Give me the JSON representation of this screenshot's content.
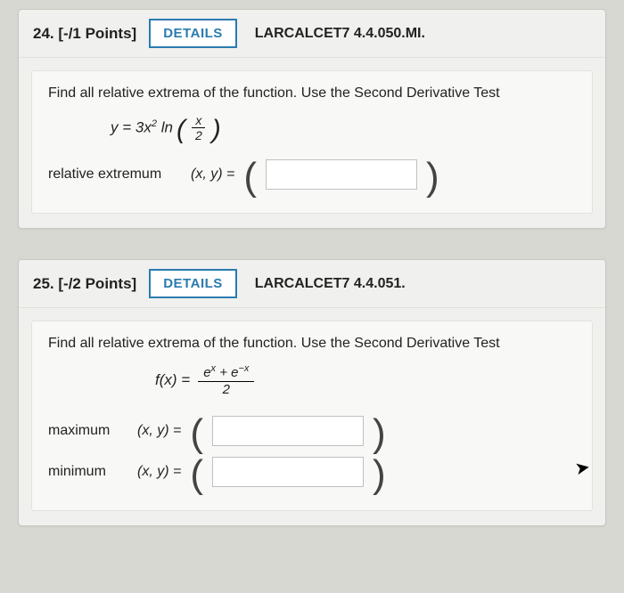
{
  "q24": {
    "number": "24.",
    "points": "[-/1 Points]",
    "details_label": "DETAILS",
    "ref": "LARCALCET7 4.4.050.MI.",
    "prompt": "Find all relative extrema of the function. Use the Second Derivative Test",
    "formula_lhs": "y = 3x",
    "formula_sup": "2",
    "formula_ln": " ln",
    "frac_num": "x",
    "frac_den": "2",
    "rel_label": "relative extremum",
    "xy_label": "(x, y) =",
    "answer": ""
  },
  "q25": {
    "number": "25.",
    "points": "[-/2 Points]",
    "details_label": "DETAILS",
    "ref": "LARCALCET7 4.4.051.",
    "prompt": "Find all relative extrema of the function. Use the Second Derivative Test",
    "f_lhs": "f(x) =",
    "num_part1": "e",
    "num_sup1": "x",
    "num_plus": " + e",
    "num_sup2": "−x",
    "den": "2",
    "max_label": "maximum",
    "min_label": "minimum",
    "xy_label": "(x, y)  =",
    "max_answer": "",
    "min_answer": ""
  }
}
